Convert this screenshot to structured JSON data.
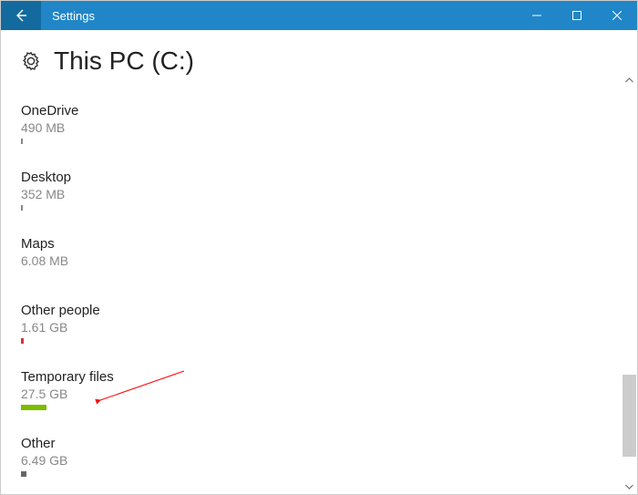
{
  "window": {
    "title": "Settings"
  },
  "page": {
    "title": "This PC (C:)"
  },
  "items": [
    {
      "name": "OneDrive",
      "size": "490 MB",
      "barWidth": "2px",
      "barColor": "#888"
    },
    {
      "name": "Desktop",
      "size": "352 MB",
      "barWidth": "2px",
      "barColor": "#888"
    },
    {
      "name": "Maps",
      "size": "6.08 MB",
      "barWidth": "0px",
      "barColor": "#888"
    },
    {
      "name": "Other people",
      "size": "1.61 GB",
      "barWidth": "3px",
      "barColor": "#d13438"
    },
    {
      "name": "Temporary files",
      "size": "27.5 GB",
      "barWidth": "28px",
      "barColor": "#7cbb00"
    },
    {
      "name": "Other",
      "size": "6.49 GB",
      "barWidth": "6px",
      "barColor": "#666"
    }
  ]
}
